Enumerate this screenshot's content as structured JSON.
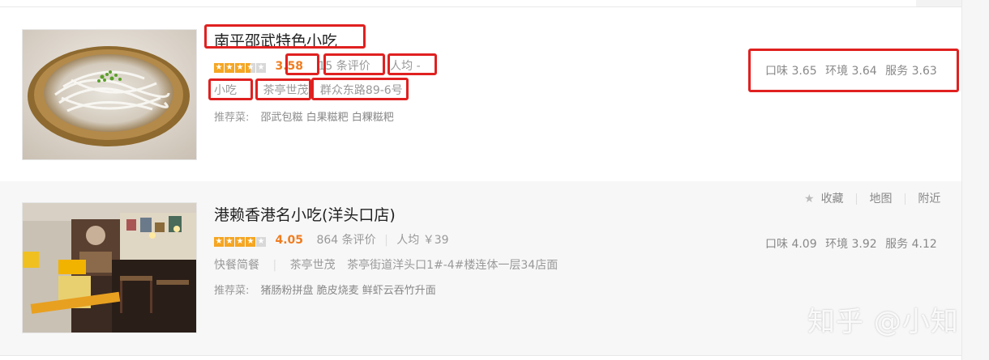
{
  "colors": {
    "accent": "#ef7d20",
    "highlight_box": "#e02020",
    "star": "#f5a623"
  },
  "shops": [
    {
      "name": "南平邵武特色小吃",
      "star_rating": 3.5,
      "score": "3.58",
      "reviews": "15 条评价",
      "avg_price": "人均 -",
      "category": "小吃",
      "area": "茶亭世茂",
      "address": "群众东路89-6号",
      "recommend_label": "推荐菜:",
      "dishes": "邵武包糍 白果糍粑 白粿糍粑",
      "taste": "口味 3.65",
      "environment": "环境 3.64",
      "service": "服务 3.63",
      "image_icon": "noodle-bowl-photo"
    },
    {
      "name": "港赖香港名小吃(洋头口店)",
      "star_rating": 4,
      "score": "4.05",
      "reviews": "864 条评价",
      "avg_price": "人均 ￥39",
      "category": "快餐简餐",
      "area": "茶亭世茂",
      "address": "茶亭街道洋头口1#-4#楼连体一层34店面",
      "recommend_label": "推荐菜:",
      "dishes": "猪肠粉拼盘 脆皮烧麦 鲜虾云吞竹升面",
      "taste": "口味 4.09",
      "environment": "环境 3.92",
      "service": "服务 4.12",
      "image_icon": "restaurant-storefront-photo",
      "actions": {
        "favorite": "收藏",
        "map": "地图",
        "nearby": "附近"
      }
    }
  ],
  "watermark": "知乎 @小知"
}
